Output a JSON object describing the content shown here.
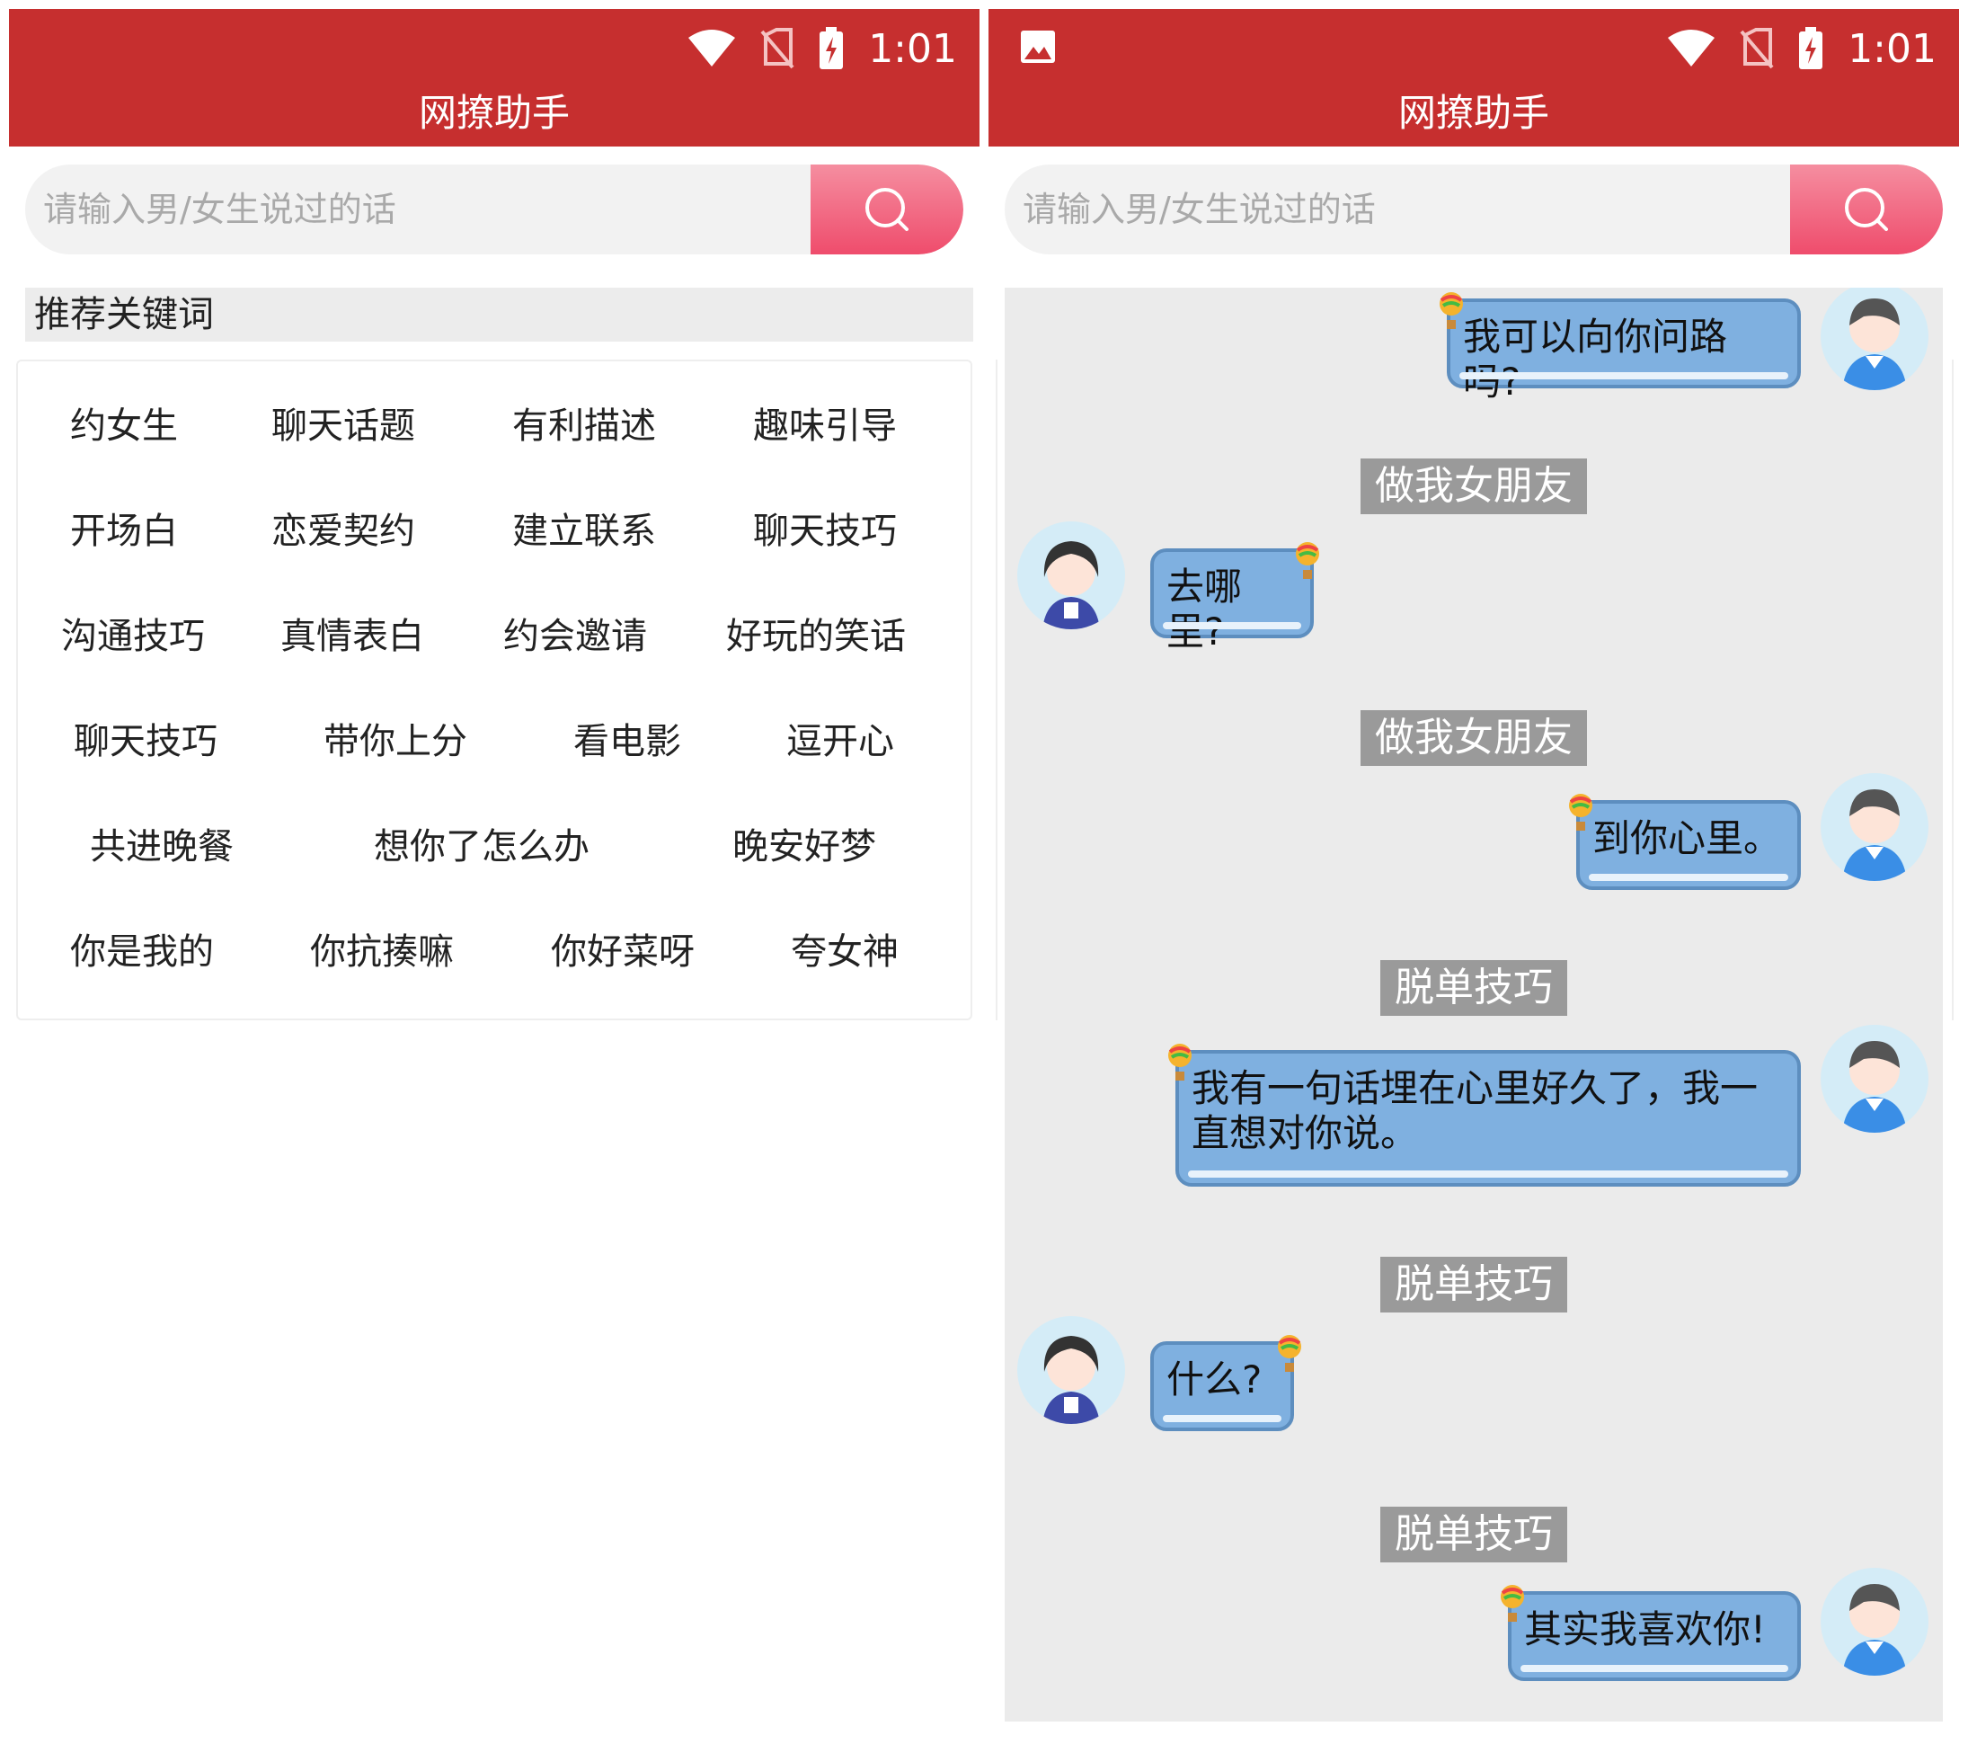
{
  "status_bar": {
    "time": "1:01"
  },
  "app_title": "网撩助手",
  "search": {
    "placeholder": "请输入男/女生说过的话"
  },
  "recommend": {
    "header": "推荐关键词",
    "rows": [
      [
        "约女生",
        "聊天话题",
        "有利描述",
        "趣味引导"
      ],
      [
        "开场白",
        "恋爱契约",
        "建立联系",
        "聊天技巧"
      ],
      [
        "沟通技巧",
        "真情表白",
        "约会邀请",
        "好玩的笑话"
      ],
      [
        "聊天技巧",
        "带你上分",
        "看电影",
        "逗开心"
      ],
      [
        "共进晚餐",
        "想你了怎么办",
        "晚安好梦"
      ],
      [
        "你是我的",
        "你抗揍嘛",
        "你好菜呀",
        "夸女神"
      ]
    ]
  },
  "chat": {
    "messages": [
      {
        "sender": "boy",
        "text": "我可以向你问路吗?"
      },
      {
        "tag": "做我女朋友"
      },
      {
        "sender": "girl",
        "text": "去哪里?"
      },
      {
        "tag": "做我女朋友"
      },
      {
        "sender": "boy",
        "text": "到你心里。"
      },
      {
        "tag": "脱单技巧"
      },
      {
        "sender": "boy",
        "text": "我有一句话埋在心里好久了，我一直想对你说。"
      },
      {
        "tag": "脱单技巧"
      },
      {
        "sender": "girl",
        "text": "什么?"
      },
      {
        "tag": "脱单技巧"
      },
      {
        "sender": "boy",
        "text": "其实我喜欢你!"
      }
    ]
  },
  "colors": {
    "app_bar": "#c62f2f",
    "search_button": "#ef4c6c",
    "bubble": "#7fb0e0",
    "tag_bg": "#9a9a9a",
    "chat_bg": "#ebebeb"
  },
  "icons": [
    "wifi-icon",
    "no-sim-icon",
    "battery-charging-icon",
    "image-icon",
    "search-icon",
    "boy-avatar",
    "girl-avatar",
    "balloon-icon"
  ]
}
